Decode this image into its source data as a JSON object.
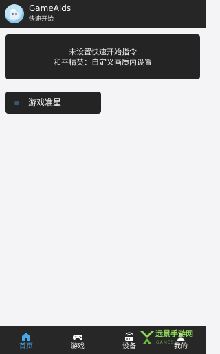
{
  "header": {
    "title": "GameAids",
    "subtitle": "快速开始",
    "logo_icon": "app-logo-icon"
  },
  "card": {
    "line1": "未设置快速开始指令",
    "line2": "和平精英：自定义画质内设置"
  },
  "aim_item": {
    "label": "游戏准星",
    "icon": "dot-icon"
  },
  "tabbar": {
    "tabs": [
      {
        "label": "首页",
        "icon": "home-icon",
        "active": true
      },
      {
        "label": "游戏",
        "icon": "gamepad-icon",
        "active": false
      },
      {
        "label": "设备",
        "icon": "router-icon",
        "active": false
      },
      {
        "label": "我的",
        "icon": "profile-icon",
        "active": false
      }
    ]
  },
  "watermark": {
    "text": "远景手游网",
    "sub": "GAMESM"
  },
  "colors": {
    "background": "#f4f4f6",
    "panel": "#242424",
    "accent": "#48a7e8",
    "header": "#262626"
  }
}
